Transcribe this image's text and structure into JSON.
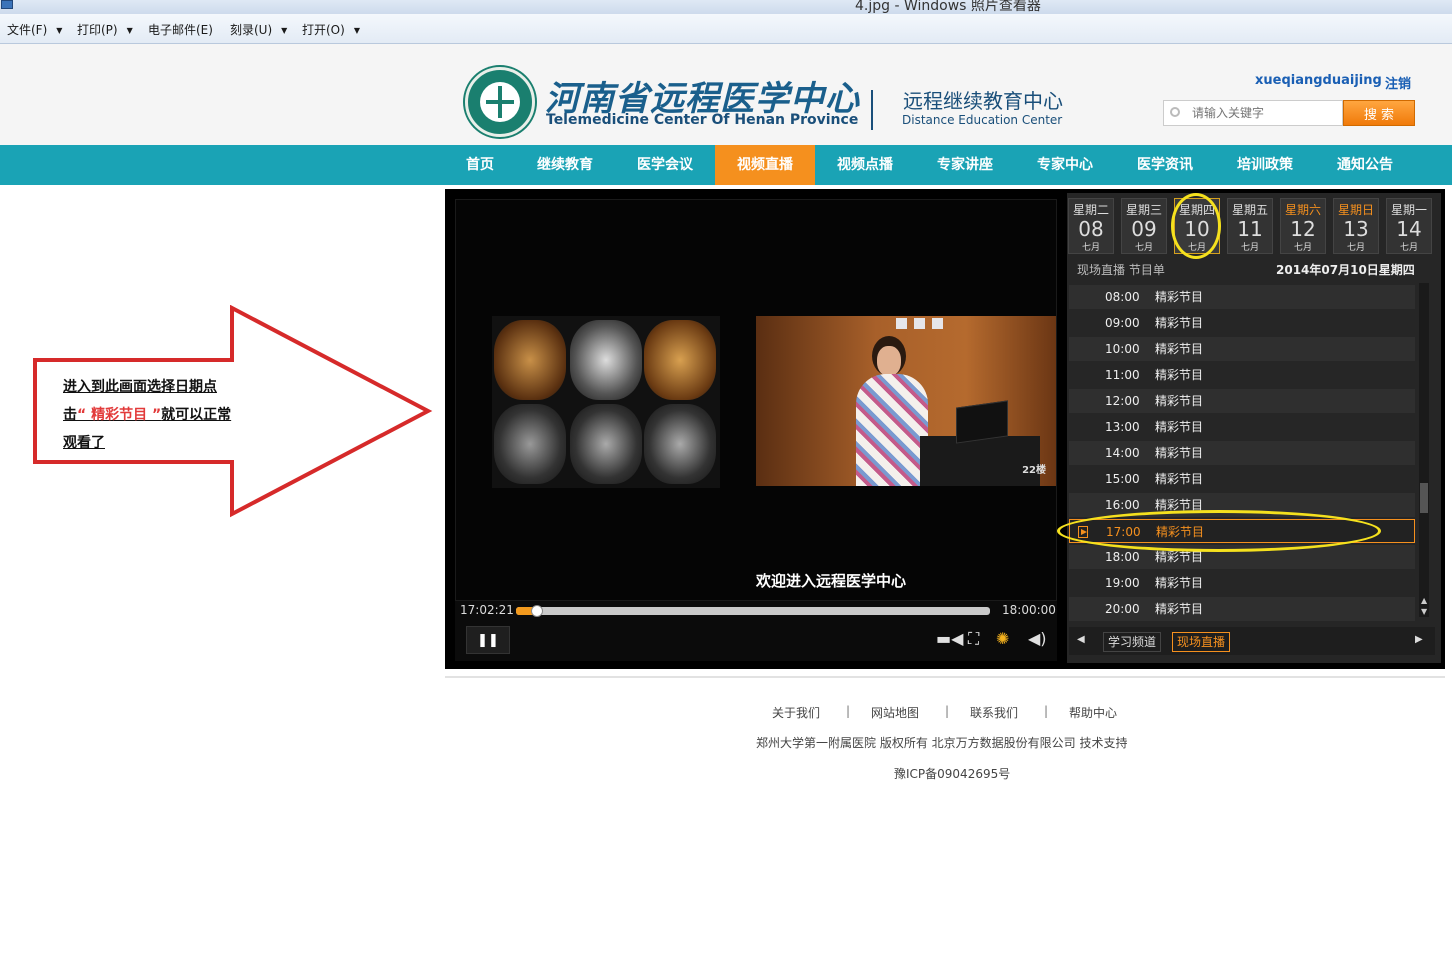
{
  "window": {
    "title": "4.jpg - Windows 照片查看器"
  },
  "menubar": {
    "items": [
      "文件(F)",
      "打印(P)",
      "电子邮件(E)",
      "刻录(U)",
      "打开(O)"
    ]
  },
  "header": {
    "site_name_cn": "河南省远程医学中心",
    "site_name_en": "Telemedicine Center Of Henan Province",
    "center_cn": "远程继续教育中心",
    "center_en": "Distance  Education Center",
    "username": "xueqiangduaijing",
    "logout_label": "注销",
    "search_placeholder": "请输入关键字",
    "search_button": "搜 索"
  },
  "nav": {
    "items": [
      "首页",
      "继续教育",
      "医学会议",
      "视频直播",
      "视频点播",
      "专家讲座",
      "专家中心",
      "医学资讯",
      "培训政策",
      "通知公告"
    ],
    "active_index": 3
  },
  "annotation": {
    "line1": "进入到此画面选择日期点",
    "line2_prefix": "击",
    "highlight": "“ 精彩节目 ”",
    "line2_suffix": "就可以正常",
    "line3": "观看了"
  },
  "player": {
    "caption": "欢迎进入远程医学中心",
    "camera_label": "22楼",
    "time_current": "17:02:21",
    "time_total": "18:00:00",
    "progress": 0.04,
    "pause_label": "❚❚"
  },
  "schedule": {
    "days": [
      {
        "weekday": "星期二",
        "date": "08",
        "month": "七月",
        "weekend": false
      },
      {
        "weekday": "星期三",
        "date": "09",
        "month": "七月",
        "weekend": false
      },
      {
        "weekday": "星期四",
        "date": "10",
        "month": "七月",
        "weekend": false
      },
      {
        "weekday": "星期五",
        "date": "11",
        "month": "七月",
        "weekend": false
      },
      {
        "weekday": "星期六",
        "date": "12",
        "month": "七月",
        "weekend": true
      },
      {
        "weekday": "星期日",
        "date": "13",
        "month": "七月",
        "weekend": true
      },
      {
        "weekday": "星期一",
        "date": "14",
        "month": "七月",
        "weekend": false
      }
    ],
    "selected_index": 2,
    "label": "现场直播 节目单",
    "date_text": "2014年07月10日星期四",
    "programs": [
      {
        "time": "08:00",
        "name": "精彩节目"
      },
      {
        "time": "09:00",
        "name": "精彩节目"
      },
      {
        "time": "10:00",
        "name": "精彩节目"
      },
      {
        "time": "11:00",
        "name": "精彩节目"
      },
      {
        "time": "12:00",
        "name": "精彩节目"
      },
      {
        "time": "13:00",
        "name": "精彩节目"
      },
      {
        "time": "14:00",
        "name": "精彩节目"
      },
      {
        "time": "15:00",
        "name": "精彩节目"
      },
      {
        "time": "16:00",
        "name": "精彩节目"
      },
      {
        "time": "17:00",
        "name": "精彩节目"
      },
      {
        "time": "18:00",
        "name": "精彩节目"
      },
      {
        "time": "19:00",
        "name": "精彩节目"
      },
      {
        "time": "20:00",
        "name": "精彩节目"
      }
    ],
    "current_index": 9,
    "channel_tabs": {
      "study": "学习频道",
      "live": "现场直播"
    }
  },
  "footer": {
    "links": [
      "关于我们",
      "网站地图",
      "联系我们",
      "帮助中心"
    ],
    "copyright": "郑州大学第一附属医院  版权所有  北京万方数据股份有限公司  技术支持",
    "icp": "豫ICP备09042695号"
  },
  "colors": {
    "nav_bg": "#1aa3b5",
    "accent": "#f5901e",
    "highlight_ring": "#f5e11e",
    "arrow": "#d62a2a"
  }
}
